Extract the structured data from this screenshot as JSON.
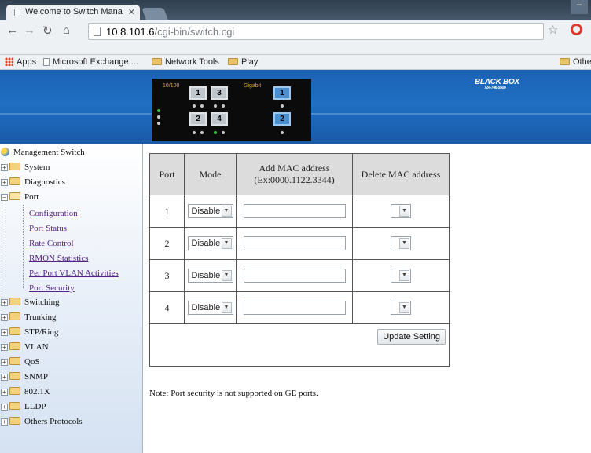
{
  "browser": {
    "tab_title": "Welcome to Switch Mana",
    "url_host": "10.8.101.6",
    "url_path": "/cgi-bin/switch.cgi",
    "bookmarks": [
      "Apps",
      "Microsoft Exchange ...",
      "Network Tools",
      "Play"
    ],
    "other_bookmarks": "Other"
  },
  "device": {
    "label_10_100": "10/100",
    "label_gigabit": "Gigabit",
    "ports_fast": [
      "1",
      "3",
      "2",
      "4"
    ],
    "ports_gig": [
      "1",
      "2"
    ],
    "brand": "BLACK BOX",
    "brand_phone": "724-746-5500"
  },
  "nav": {
    "root": "Management Switch",
    "system": "System",
    "diagnostics": "Diagnostics",
    "port": "Port",
    "port_children": [
      "Configuration",
      "Port Status",
      "Rate Control",
      "RMON Statistics",
      "Per Port VLAN Activities",
      "Port Security"
    ],
    "rest": [
      "Switching",
      "Trunking",
      "STP/Ring",
      "VLAN",
      "QoS",
      "SNMP",
      "802.1X",
      "LLDP",
      "Others Protocols"
    ]
  },
  "table": {
    "headers": {
      "port": "Port",
      "mode": "Mode",
      "add_mac": "Add MAC address",
      "add_mac_hint": "(Ex:0000.1122.3344)",
      "delete_mac": "Delete MAC address"
    },
    "rows": [
      {
        "port": "1",
        "mode": "Disable",
        "mac": ""
      },
      {
        "port": "2",
        "mode": "Disable",
        "mac": ""
      },
      {
        "port": "3",
        "mode": "Disable",
        "mac": ""
      },
      {
        "port": "4",
        "mode": "Disable",
        "mac": ""
      }
    ],
    "update_label": "Update Setting"
  },
  "note": "Note: Port security is not supported on GE ports."
}
